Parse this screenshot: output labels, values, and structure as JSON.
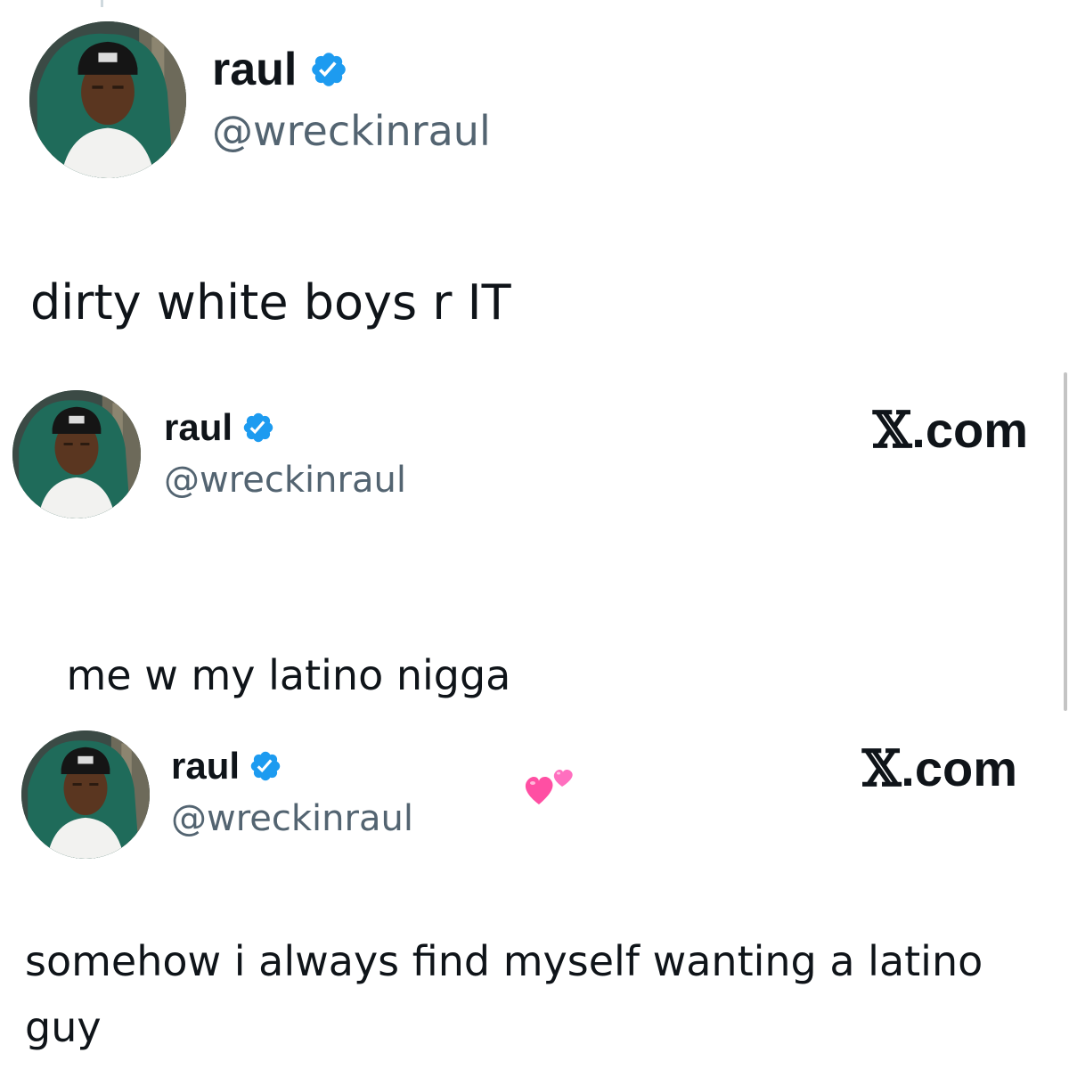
{
  "tweets": [
    {
      "display_name": "raul",
      "handle": "@wreckinraul",
      "verified": true,
      "brand": "",
      "text": "dirty white boys r IT"
    },
    {
      "display_name": "raul",
      "handle": "@wreckinraul",
      "verified": true,
      "brand": "X.com",
      "text": "me w my latino nigga",
      "emoji": "two-hearts"
    },
    {
      "display_name": "raul",
      "handle": "@wreckinraul",
      "verified": true,
      "brand": "X.com",
      "text": "somehow i always find myself wanting a latino\nguy"
    }
  ],
  "brand_parts": {
    "mark": "𝕏",
    "suffix": ".com"
  },
  "colors": {
    "verified_blue": "#1d9bf0",
    "handle_gray": "#536471",
    "text": "#0f1419",
    "heart_pink": "#ff4fa3"
  },
  "icons": [
    "verified-badge-icon",
    "two-hearts-icon",
    "x-logo-icon"
  ]
}
